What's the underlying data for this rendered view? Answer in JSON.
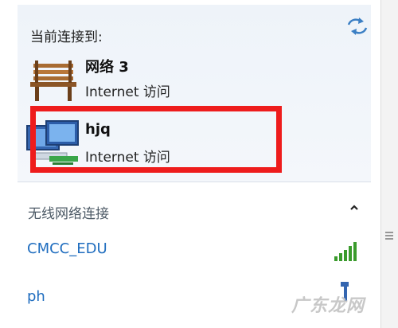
{
  "panel": {
    "title": "当前连接到:",
    "refresh_icon": "refresh-arrows-icon"
  },
  "connected_networks": [
    {
      "name": "网络  3",
      "status": "Internet 访问",
      "icon": "public-network-bench-icon"
    },
    {
      "name": "hjq",
      "status": "Internet 访问",
      "icon": "computer-network-icon",
      "highlighted": true
    }
  ],
  "wireless": {
    "section_title": "无线网络连接",
    "collapse_icon": "chevron-up-icon",
    "networks": [
      {
        "name": "CMCC_EDU",
        "signal_icon": "signal-strength-icon"
      },
      {
        "name": "ph",
        "signal_icon": "signal-strength-icon"
      }
    ]
  },
  "watermark": "广东龙网",
  "colors": {
    "highlight_border": "#ee1c1c",
    "wifi_link": "#1f6dbf",
    "signal_green": "#3a9b2c"
  }
}
